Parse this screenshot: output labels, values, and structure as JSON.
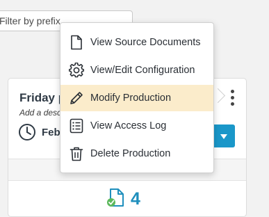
{
  "filter": {
    "placeholder": "Filter by prefix"
  },
  "card": {
    "title": "Friday p",
    "description": "Add a desc",
    "date": "Feb",
    "doc_count": "4"
  },
  "menu": {
    "items": [
      {
        "label": "View Source Documents",
        "icon": "document-icon",
        "active": false
      },
      {
        "label": "View/Edit Configuration",
        "icon": "gear-icon",
        "active": false
      },
      {
        "label": "Modify Production",
        "icon": "pencil-icon",
        "active": true
      },
      {
        "label": "View Access Log",
        "icon": "list-icon",
        "active": false
      },
      {
        "label": "Delete Production",
        "icon": "trash-icon",
        "active": false
      }
    ]
  },
  "colors": {
    "accent": "#1a97c9",
    "highlight": "#fbeccb",
    "count_text": "#1f8fbd",
    "check_green": "#5cb85c"
  }
}
